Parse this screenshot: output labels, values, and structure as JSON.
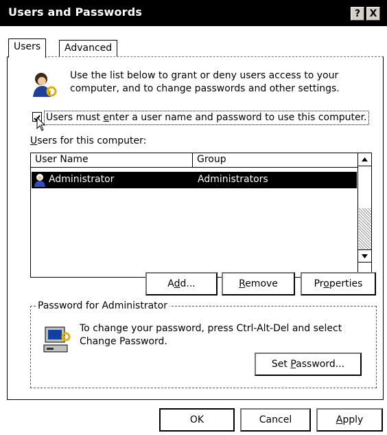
{
  "window": {
    "title": "Users and Passwords",
    "help_label": "?",
    "close_label": "X"
  },
  "tabs": [
    {
      "label": "Users"
    },
    {
      "label": "Advanced"
    }
  ],
  "intro": {
    "line1": "Use the list below to grant or deny users access to your",
    "line2": "computer, and to change passwords and other settings."
  },
  "checkbox": {
    "label_pre": "Users must ",
    "label_u": "e",
    "label_post": "nter a user name and password to use this computer.",
    "checked": true
  },
  "users_list": {
    "label_u": "U",
    "label_post": "sers for this computer:",
    "columns": [
      "User Name",
      "Group"
    ],
    "rows": [
      {
        "user": "Administrator",
        "group": "Administrators"
      }
    ]
  },
  "buttons": {
    "add_pre": "A",
    "add_u": "d",
    "add_post": "d...",
    "remove_u": "R",
    "remove_post": "emove",
    "properties_pre": "Pr",
    "properties_u": "o",
    "properties_post": "perties"
  },
  "password_group": {
    "legend": "Password for Administrator",
    "line1": "To change your password, press Ctrl-Alt-Del and select",
    "line2": "Change Password.",
    "set_password_pre": "Set ",
    "set_password_u": "P",
    "set_password_post": "assword..."
  },
  "dialog_buttons": {
    "ok": "OK",
    "cancel": "Cancel",
    "apply_u": "A",
    "apply_post": "pply"
  },
  "colors": {
    "selection": "#000000",
    "titlebar": "#000000"
  }
}
